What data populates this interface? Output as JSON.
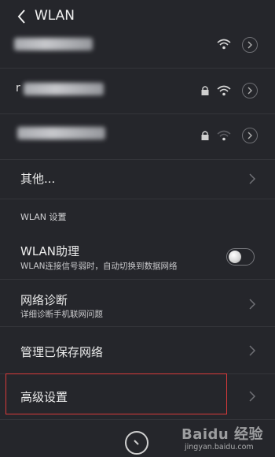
{
  "header": {
    "title": "WLAN"
  },
  "networks": [
    {
      "name_visible": "",
      "locked": false,
      "signal": "full"
    },
    {
      "name_visible": "r",
      "locked": true,
      "signal": "full"
    },
    {
      "name_visible": "",
      "locked": true,
      "signal": "weak"
    }
  ],
  "more_label": "其他...",
  "settings_section": "WLAN 设置",
  "assistant": {
    "title": "WLAN助理",
    "description": "WLAN连接信号弱时，自动切换到数据网络",
    "enabled": false
  },
  "diagnosis": {
    "title": "网络诊断",
    "description": "详细诊断手机联网问题"
  },
  "saved_networks_label": "管理已保存网络",
  "advanced_label": "高级设置",
  "icons": {
    "back": "back-arrow-icon",
    "wifi": "wifi-signal-icon",
    "lock": "lock-icon",
    "detail": "chevron-circle-icon",
    "chevron": "chevron-right-icon",
    "bottom": "circle-button-icon"
  },
  "colors": {
    "background": "#25262b",
    "highlight": "#d83a3a"
  },
  "watermark": {
    "brand": "Baidu 经验",
    "url": "jingyan.baidu.com"
  }
}
